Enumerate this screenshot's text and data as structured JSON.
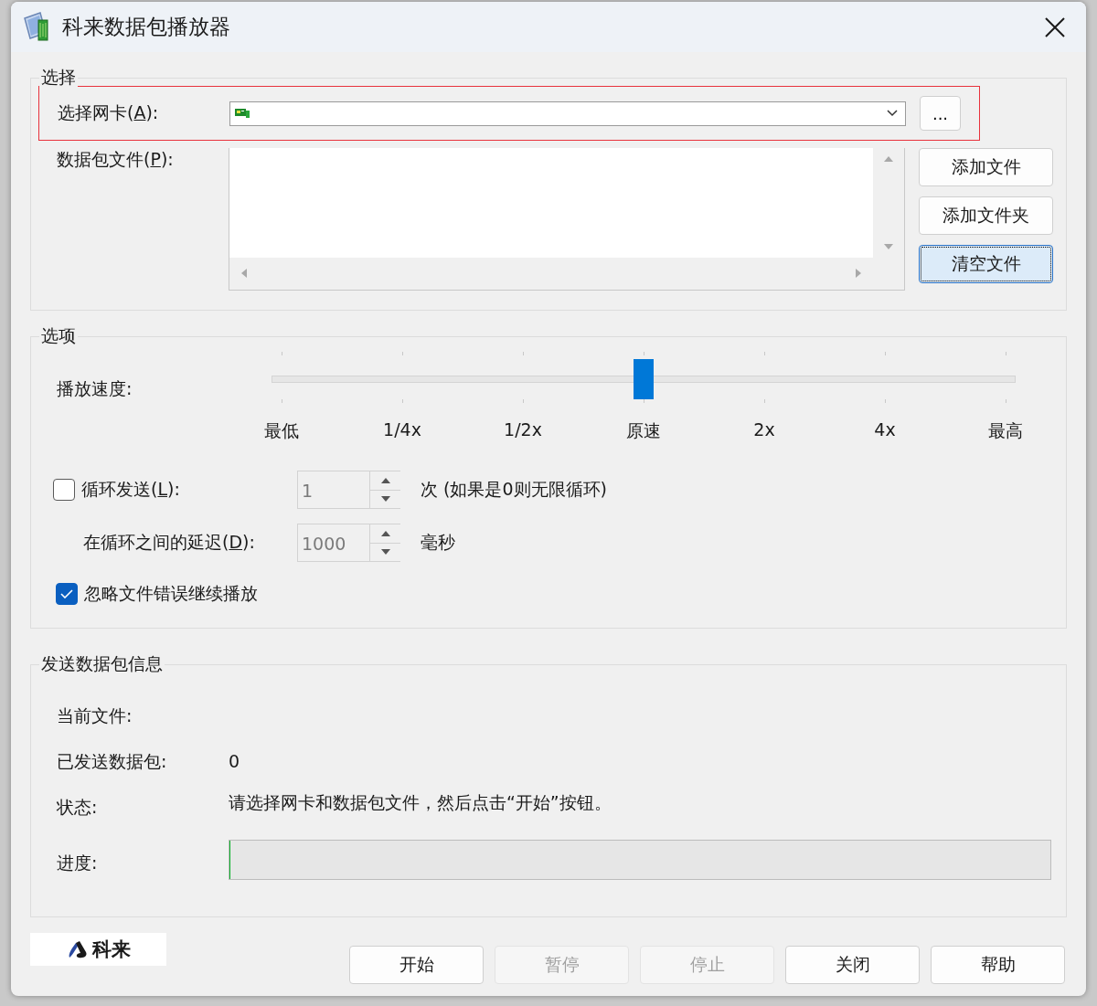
{
  "window": {
    "title": "科来数据包播放器"
  },
  "select_group": {
    "title": "选择",
    "nic": {
      "label_before": "选择网卡(",
      "mnemonic": "A",
      "label_after": "):",
      "highlighted": true,
      "browse_button": "..."
    },
    "files": {
      "label_before": "数据包文件(",
      "mnemonic": "P",
      "label_after": "):"
    },
    "file_buttons": [
      {
        "label": "添加文件",
        "selected": false
      },
      {
        "label": "添加文件夹",
        "selected": false
      },
      {
        "label": "清空文件",
        "selected": true
      }
    ]
  },
  "options_group": {
    "title": "选项",
    "speed": {
      "label": "播放速度:",
      "level": 0.5,
      "ticks": [
        "最低",
        "1/4x",
        "1/2x",
        "原速",
        "2x",
        "4x",
        "最高"
      ]
    },
    "loop": {
      "label_before": "循环发送(",
      "mnemonic": "L",
      "label_after": "):",
      "checked": false,
      "value": "1",
      "suffix": "次 (如果是0则无限循环)"
    },
    "delay": {
      "label_before": "在循环之间的延迟(",
      "mnemonic": "D",
      "label_after": "):",
      "value": "1000",
      "suffix": "毫秒"
    },
    "ignore_errors": {
      "label": "忽略文件错误继续播放",
      "checked": true
    }
  },
  "info_group": {
    "title": "发送数据包信息",
    "current_file": {
      "label": "当前文件:"
    },
    "sent_packets": {
      "label": "已发送数据包:",
      "value": "0"
    },
    "status": {
      "label": "状态:",
      "value": "请选择网卡和数据包文件，然后点击“开始”按钮。"
    },
    "progress": {
      "label": "进度:",
      "level": 0
    }
  },
  "logo": {
    "text": "科来"
  },
  "buttons": [
    {
      "label": "开始",
      "disabled": false
    },
    {
      "label": "暂停",
      "disabled": true
    },
    {
      "label": "停止",
      "disabled": true
    },
    {
      "label": "关闭",
      "disabled": false
    },
    {
      "label": "帮助",
      "disabled": false
    }
  ]
}
